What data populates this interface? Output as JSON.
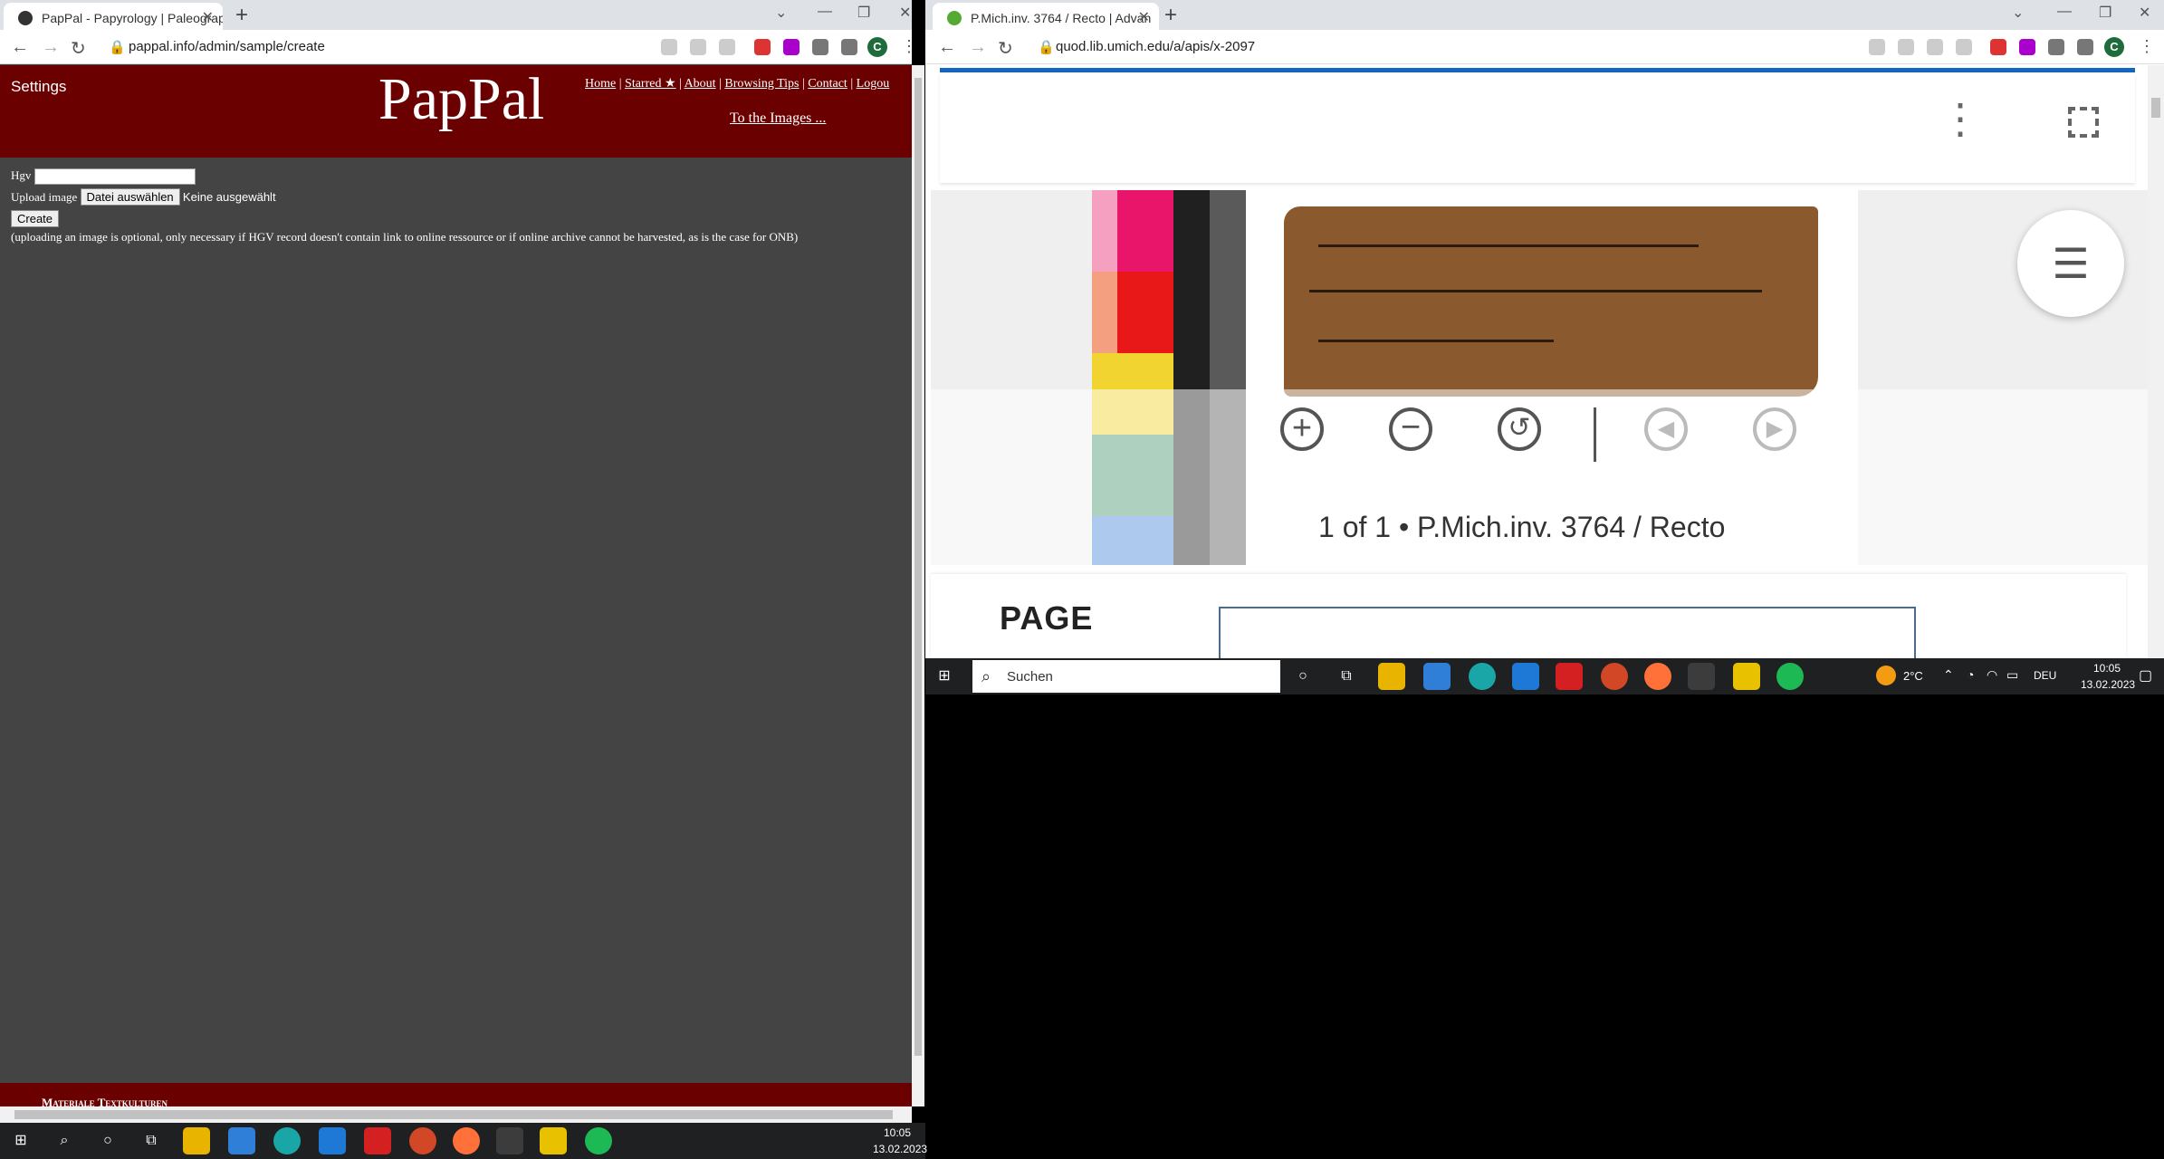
{
  "left_browser": {
    "tab_title": "PapPal - Papyrology | Paleograph",
    "url": "pappal.info/admin/sample/create",
    "profile_initial": "C"
  },
  "right_browser": {
    "tab_title": "P.Mich.inv. 3764 / Recto | Advan",
    "url": "quod.lib.umich.edu/a/apis/x-2097",
    "profile_initial": "C"
  },
  "pappal": {
    "settings_label": "Settings",
    "logo": "PapPal",
    "nav": [
      "Home",
      "Starred ★",
      "About",
      "Browsing Tips",
      "Contact",
      "Logou"
    ],
    "nav_separator": "|",
    "images_link": "To the Images ...",
    "hgv_label": "Hgv",
    "hgv_value": "",
    "upload_label": "Upload image",
    "file_button": "Datei auswählen",
    "file_status": "Keine ausgewählt",
    "create_button": "Create",
    "hint": "(uploading an image is optional, only necessary if HGV record doesn't contain link to online ressource or if online archive cannot be harvested, as is the case for ONB)",
    "footer_text": "Materiale Textkulturen"
  },
  "viewer": {
    "caption": "1 of 1 • P.Mich.inv. 3764 / Recto",
    "page_heading": "PAGE"
  },
  "taskbar_right": {
    "search_placeholder": "Suchen",
    "temperature": "2°C",
    "language": "DEU",
    "time": "10:05",
    "date": "13.02.2023"
  },
  "taskbar_left": {
    "time": "10:05",
    "date": "13.02.2023"
  },
  "colors": {
    "pappal_header": "#6b0000",
    "pappal_body": "#444444",
    "taskbar": "#1f2022",
    "chrome_tabstrip": "#dee1e6",
    "viewer_accent": "#1565c0"
  }
}
